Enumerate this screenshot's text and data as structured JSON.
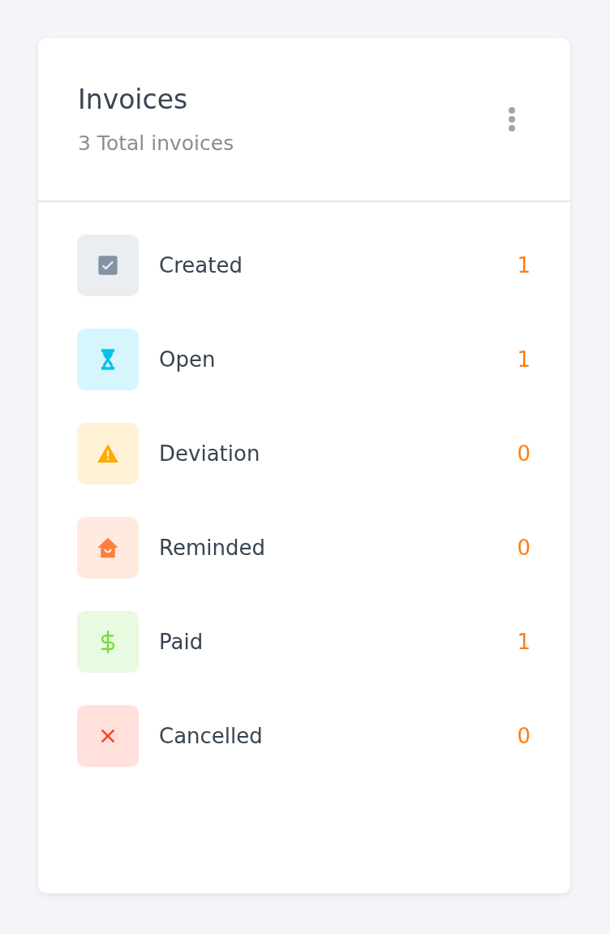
{
  "card": {
    "title": "Invoices",
    "subtitle": "3 Total invoices"
  },
  "statuses": [
    {
      "label": "Created",
      "count": "1",
      "kind": "check",
      "color": "#8592a3"
    },
    {
      "label": "Open",
      "count": "1",
      "kind": "hourglass",
      "color": "#03c3ec"
    },
    {
      "label": "Deviation",
      "count": "0",
      "kind": "warning",
      "color": "#ffab00"
    },
    {
      "label": "Reminded",
      "count": "0",
      "kind": "house",
      "color": "#fd7e3f"
    },
    {
      "label": "Paid",
      "count": "1",
      "kind": "dollar",
      "color": "#71dd37"
    },
    {
      "label": "Cancelled",
      "count": "0",
      "kind": "cross",
      "color": "#ff3e1d"
    }
  ]
}
